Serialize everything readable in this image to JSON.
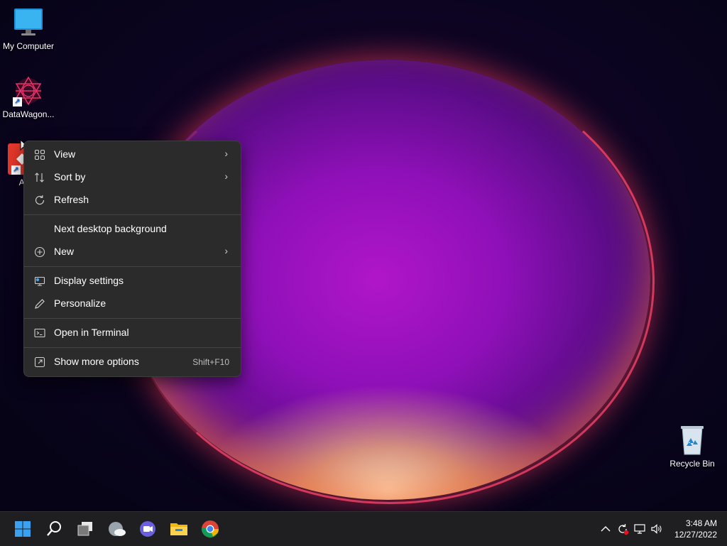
{
  "desktop": {
    "icons": [
      {
        "label": "My Computer"
      },
      {
        "label": "DataWagon..."
      },
      {
        "label": "Any"
      },
      {
        "label": "Recycle Bin"
      }
    ]
  },
  "context_menu": {
    "items": [
      {
        "label": "View",
        "icon": "grid-icon",
        "submenu": true
      },
      {
        "label": "Sort by",
        "icon": "sort-icon",
        "submenu": true
      },
      {
        "label": "Refresh",
        "icon": "refresh-icon"
      },
      {
        "label": "Next desktop background"
      },
      {
        "label": "New",
        "icon": "plus-circle-icon",
        "submenu": true
      },
      {
        "label": "Display settings",
        "icon": "display-icon"
      },
      {
        "label": "Personalize",
        "icon": "pen-icon"
      },
      {
        "label": "Open in Terminal",
        "icon": "terminal-icon"
      },
      {
        "label": "Show more options",
        "icon": "share-icon",
        "shortcut": "Shift+F10"
      }
    ]
  },
  "taskbar": {
    "apps": [
      "start-icon",
      "search-icon",
      "task-view-icon",
      "widgets-icon",
      "chat-icon",
      "file-explorer-icon",
      "chrome-icon"
    ],
    "clock": {
      "time": "3:48 AM",
      "date": "12/27/2022"
    }
  },
  "colors": {
    "menu_bg": "#2b2b2b",
    "accent": "#0078d4",
    "taskbar_bg": "#1f1f22"
  }
}
